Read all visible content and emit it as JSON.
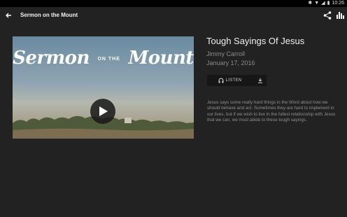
{
  "status_bar": {
    "time": "10:26"
  },
  "app_bar": {
    "title": "Sermon on the Mount"
  },
  "video": {
    "title_word1": "Sermon",
    "title_small": "ON THE",
    "title_word2": "Mount"
  },
  "sermon": {
    "title": "Tough Sayings Of Jesus",
    "speaker": "Jimmy Carroll",
    "date": "January 17, 2016",
    "listen_label": "LISTEN",
    "description": "Jesus says some really hard things in the Word about how we should behave and act. Sometimes they are hard to implement in our lives, but if we wish to live in the fullest relationship with Jesus that we can, we must abide to these tough sayings."
  }
}
